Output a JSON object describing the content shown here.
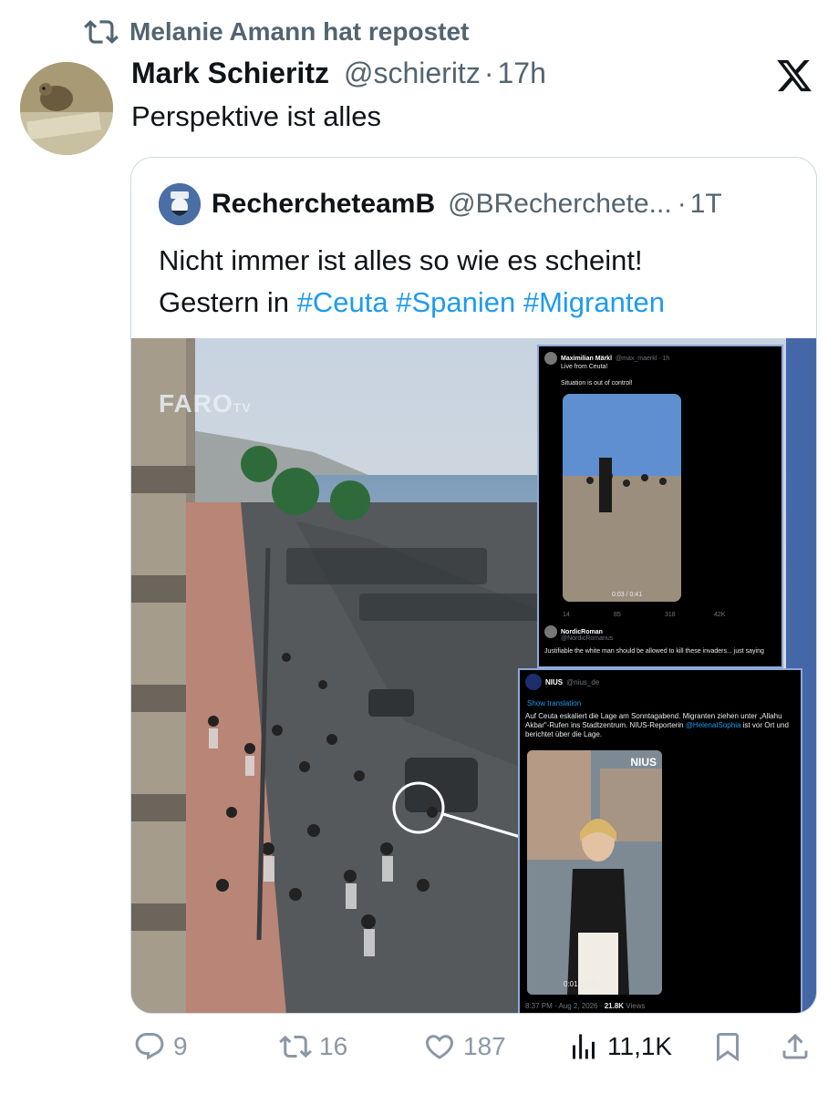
{
  "repost": {
    "text": "Melanie Amann hat repostet",
    "icon": "repost-icon"
  },
  "tweet": {
    "name": "Mark Schieritz",
    "handle": "@schieritz",
    "dot": "·",
    "time": "17h",
    "text": "Perspektive ist alles"
  },
  "quote": {
    "name": "RecherchetеamB",
    "handle": "@BRecherchete...",
    "dot": "·",
    "time": "1T",
    "text_line1": "Nicht immer ist alles so wie es scheint!",
    "text_line2_prefix": "Gestern in ",
    "hashtags": [
      "#Ceuta",
      "#Spanien",
      "#Migranten"
    ]
  },
  "media": {
    "watermark": "FARO",
    "watermark_sub": "TV",
    "embed1": {
      "name": "Maximilian Märkl",
      "handle": "@max_maerkl · 1h",
      "line1": "Live from Ceuta!",
      "line2": "Situation is out of control!",
      "video_time": "0:03 / 0:41",
      "stats": [
        "14",
        "85",
        "318",
        "42K"
      ],
      "reply_name": "NordicRoman",
      "reply_handle": "@NordicRomanus",
      "reply_text": "Justifiable the white man should be allowed to kill these invaders... just saying"
    },
    "embed2": {
      "name": "NIUS",
      "handle": "@nius_de",
      "show_translation": "Show translation",
      "text": "Auf Ceuta eskaliert die Lage am Sonntagabend. Migranten ziehen unter „Allahu Akbar\"-Rufen ins Stadtzentrum. NIUS-Reporterin",
      "mention": "@HelenaISophia",
      "text_end": "ist vor Ort und berichtet über die Lage.",
      "video_badge": "NIUS",
      "video_time": "0:01 / 0:30",
      "footer_time": "8:37 PM · Aug 2, 2026 · ",
      "views_count": "21.8K",
      "views_label": " Views"
    }
  },
  "actions": {
    "replies": "9",
    "reposts": "16",
    "likes": "187",
    "views": "11,1K"
  },
  "colors": {
    "link": "#1d9bf0",
    "muted": "#536471",
    "text": "#0f1419",
    "border": "#cfd9de"
  }
}
